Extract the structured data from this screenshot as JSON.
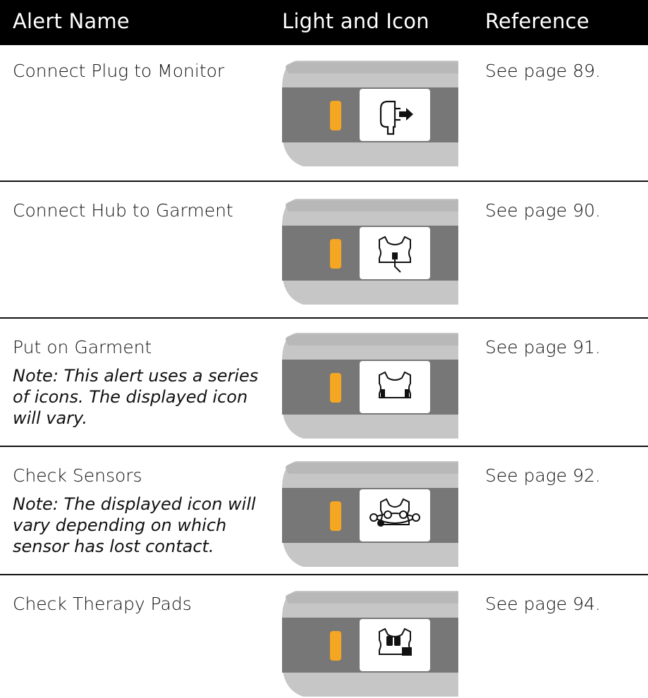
{
  "header": {
    "alert_name": "Alert Name",
    "light_and_icon": "Light and Icon",
    "reference": "Reference"
  },
  "rows": [
    {
      "name": "Connect Plug to Monitor",
      "note": "",
      "reference": "See page 89.",
      "icon": "plug-icon",
      "light_color": "#F5A623"
    },
    {
      "name": "Connect Hub to Garment",
      "note": "",
      "reference": "See page 90.",
      "icon": "garment-hub-icon",
      "light_color": "#F5A623"
    },
    {
      "name": "Put on Garment",
      "note": "Note: This alert uses a series of icons. The displayed icon will vary.",
      "reference": "See page 91.",
      "icon": "garment-icon",
      "light_color": "#F5A623"
    },
    {
      "name": "Check Sensors",
      "note": "Note: The displayed icon will vary depending on which sensor has lost contact.",
      "reference": "See page 92.",
      "icon": "garment-sensors-icon",
      "light_color": "#F5A623"
    },
    {
      "name": "Check Therapy Pads",
      "note": "",
      "reference": "See page 94.",
      "icon": "garment-pads-icon",
      "light_color": "#F5A623"
    }
  ]
}
